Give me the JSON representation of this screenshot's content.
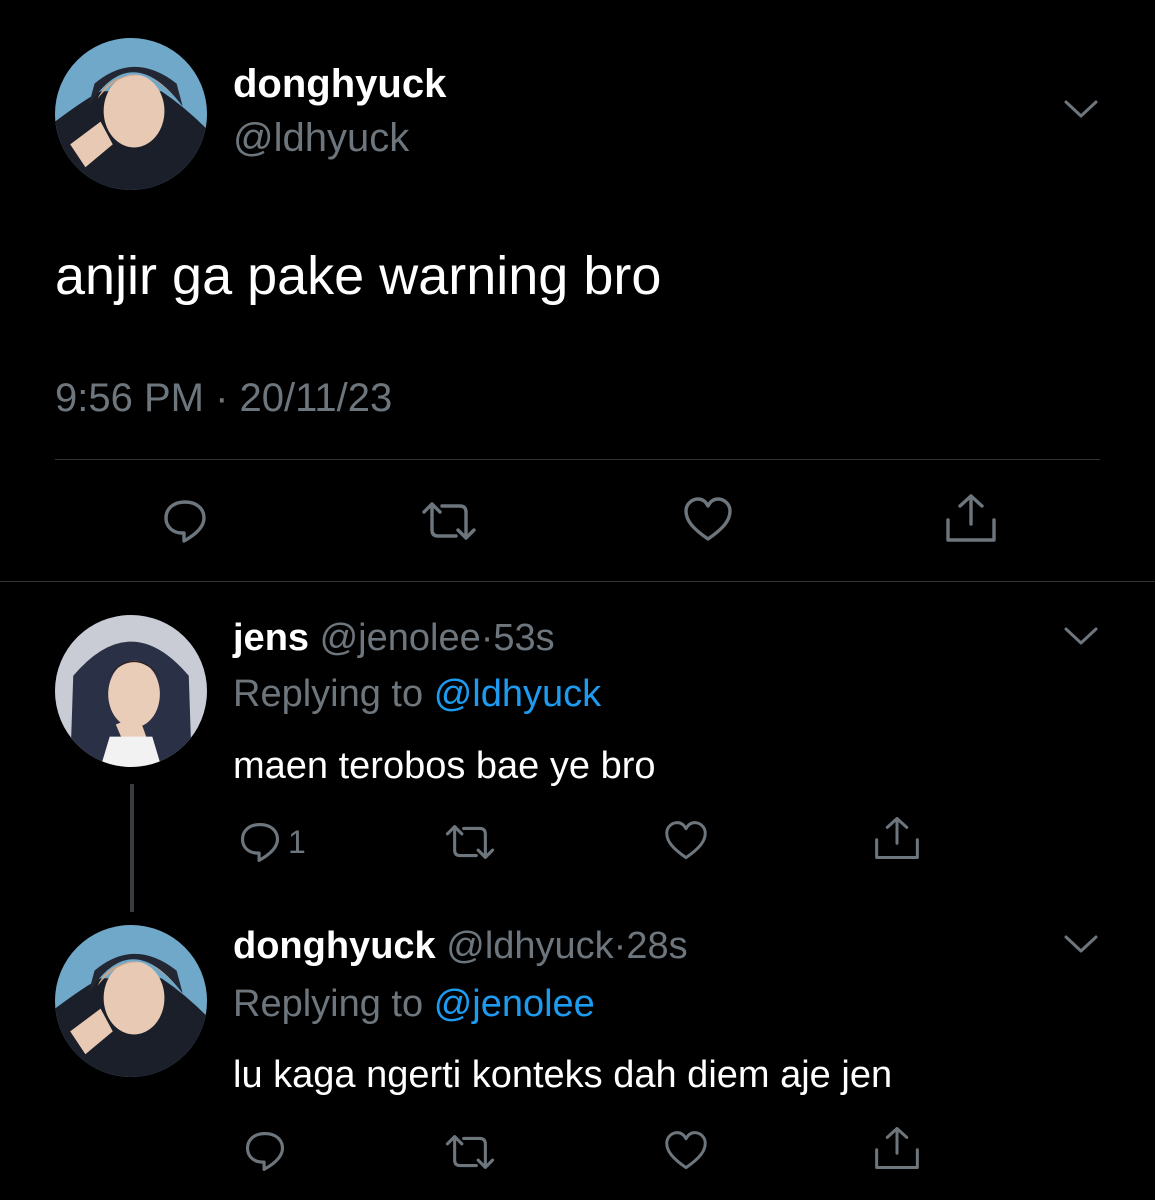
{
  "main_tweet": {
    "display_name": "donghyuck",
    "handle": "@ldhyuck",
    "text": "anjir ga pake warning bro",
    "timestamp": "9:56 PM · 20/11/23"
  },
  "replies": [
    {
      "display_name": "jens",
      "handle": "@jenolee",
      "time_sep": "·",
      "age": "53s",
      "replying_prefix": "Replying to",
      "replying_to": "@ldhyuck",
      "text": "maen terobos bae ye bro",
      "reply_count": "1"
    },
    {
      "display_name": "donghyuck",
      "handle": "@ldhyuck",
      "time_sep": "·",
      "age": "28s",
      "replying_prefix": "Replying to",
      "replying_to": "@jenolee",
      "text": "lu kaga ngerti konteks dah diem aje jen",
      "reply_count": ""
    }
  ],
  "icons": {
    "reply": "reply-icon",
    "retweet": "retweet-icon",
    "like": "heart-icon",
    "share": "share-icon",
    "more": "chevron-down-icon"
  },
  "colors": {
    "background": "#000000",
    "text": "#ffffff",
    "muted": "#6e767d",
    "link": "#1d9bf0",
    "divider": "#2f3336"
  }
}
